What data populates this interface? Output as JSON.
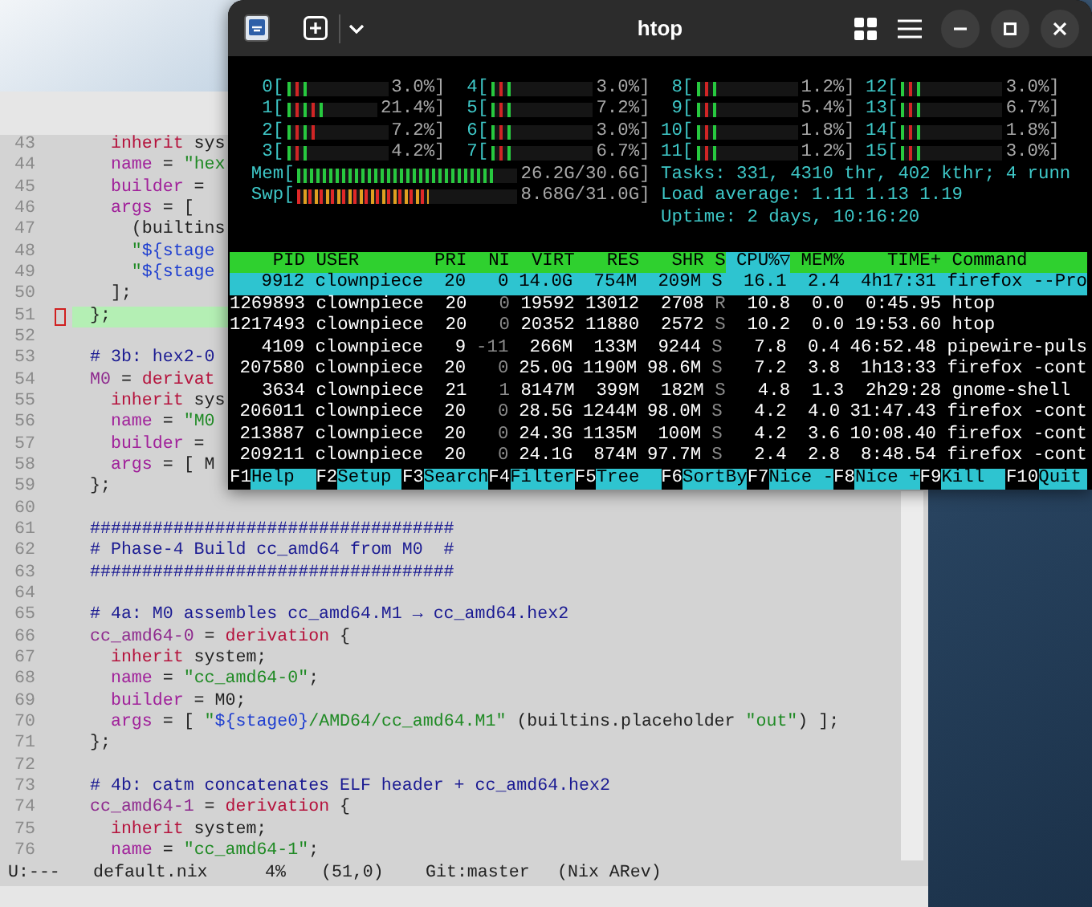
{
  "editor": {
    "lines": [
      {
        "number": "43",
        "current": false,
        "segments": [
          {
            "kind": "keyword",
            "text": "  inherit"
          },
          {
            "kind": "plain",
            "text": " sys"
          }
        ]
      },
      {
        "number": "44",
        "current": false,
        "segments": [
          {
            "kind": "attr",
            "text": "  name"
          },
          {
            "kind": "plain",
            "text": " = "
          },
          {
            "kind": "string",
            "text": "\"hex"
          }
        ]
      },
      {
        "number": "45",
        "current": false,
        "segments": [
          {
            "kind": "attr",
            "text": "  builder"
          },
          {
            "kind": "plain",
            "text": " ="
          }
        ]
      },
      {
        "number": "46",
        "current": false,
        "segments": [
          {
            "kind": "attr",
            "text": "  args"
          },
          {
            "kind": "plain",
            "text": " = ["
          }
        ]
      },
      {
        "number": "47",
        "current": false,
        "segments": [
          {
            "kind": "plain",
            "text": "    (builtins"
          }
        ]
      },
      {
        "number": "48",
        "current": false,
        "segments": [
          {
            "kind": "string",
            "text": "    \""
          },
          {
            "kind": "interp",
            "text": "${stage"
          }
        ]
      },
      {
        "number": "49",
        "current": false,
        "segments": [
          {
            "kind": "string",
            "text": "    \""
          },
          {
            "kind": "interp",
            "text": "${stage"
          }
        ]
      },
      {
        "number": "50",
        "current": false,
        "segments": [
          {
            "kind": "plain",
            "text": "  ];"
          }
        ]
      },
      {
        "number": "51",
        "current": true,
        "segments": [
          {
            "kind": "plain",
            "text": "};"
          }
        ]
      },
      {
        "number": "52",
        "current": false
      },
      {
        "number": "53",
        "current": false,
        "segments": [
          {
            "kind": "comment",
            "text": "# 3b: hex2-0"
          }
        ]
      },
      {
        "number": "54",
        "current": false,
        "segments": [
          {
            "kind": "var",
            "text": "M0"
          },
          {
            "kind": "plain",
            "text": " = "
          },
          {
            "kind": "keyword",
            "text": "derivat"
          }
        ]
      },
      {
        "number": "55",
        "current": false,
        "segments": [
          {
            "kind": "keyword",
            "text": "  inherit"
          },
          {
            "kind": "plain",
            "text": " sys"
          }
        ]
      },
      {
        "number": "56",
        "current": false,
        "segments": [
          {
            "kind": "attr",
            "text": "  name"
          },
          {
            "kind": "plain",
            "text": " = "
          },
          {
            "kind": "string",
            "text": "\"M0"
          }
        ]
      },
      {
        "number": "57",
        "current": false,
        "segments": [
          {
            "kind": "attr",
            "text": "  builder"
          },
          {
            "kind": "plain",
            "text": " ="
          }
        ]
      },
      {
        "number": "58",
        "current": false,
        "segments": [
          {
            "kind": "attr",
            "text": "  args"
          },
          {
            "kind": "plain",
            "text": " = [ M"
          }
        ]
      },
      {
        "number": "59",
        "current": false,
        "segments": [
          {
            "kind": "plain",
            "text": "};"
          }
        ]
      },
      {
        "number": "60",
        "current": false
      },
      {
        "number": "61",
        "current": false,
        "segments": [
          {
            "kind": "comment",
            "text": "###################################"
          }
        ]
      },
      {
        "number": "62",
        "current": false,
        "segments": [
          {
            "kind": "comment",
            "text": "# Phase-4 Build cc_amd64 from M0  #"
          }
        ]
      },
      {
        "number": "63",
        "current": false,
        "segments": [
          {
            "kind": "comment",
            "text": "###################################"
          }
        ]
      },
      {
        "number": "64",
        "current": false
      },
      {
        "number": "65",
        "current": false,
        "segments": [
          {
            "kind": "comment",
            "text": "# 4a: M0 assembles cc_amd64.M1 → cc_amd64.hex2"
          }
        ]
      },
      {
        "number": "66",
        "current": false,
        "segments": [
          {
            "kind": "var",
            "text": "cc_amd64-0"
          },
          {
            "kind": "plain",
            "text": " = "
          },
          {
            "kind": "keyword",
            "text": "derivation"
          },
          {
            "kind": "plain",
            "text": " {"
          }
        ]
      },
      {
        "number": "67",
        "current": false,
        "segments": [
          {
            "kind": "keyword",
            "text": "  inherit"
          },
          {
            "kind": "plain",
            "text": " system;"
          }
        ]
      },
      {
        "number": "68",
        "current": false,
        "segments": [
          {
            "kind": "attr",
            "text": "  name"
          },
          {
            "kind": "plain",
            "text": " = "
          },
          {
            "kind": "string",
            "text": "\"cc_amd64-0\""
          },
          {
            "kind": "plain",
            "text": ";"
          }
        ]
      },
      {
        "number": "69",
        "current": false,
        "segments": [
          {
            "kind": "attr",
            "text": "  builder"
          },
          {
            "kind": "plain",
            "text": " = M0;"
          }
        ]
      },
      {
        "number": "70",
        "current": false,
        "segments": [
          {
            "kind": "attr",
            "text": "  args"
          },
          {
            "kind": "plain",
            "text": " = [ "
          },
          {
            "kind": "string",
            "text": "\""
          },
          {
            "kind": "interp",
            "text": "${stage0}"
          },
          {
            "kind": "string",
            "text": "/AMD64/cc_amd64.M1\""
          },
          {
            "kind": "plain",
            "text": " (builtins.placeholder "
          },
          {
            "kind": "string",
            "text": "\"out\""
          },
          {
            "kind": "plain",
            "text": ") ];"
          }
        ]
      },
      {
        "number": "71",
        "current": false,
        "segments": [
          {
            "kind": "plain",
            "text": "};"
          }
        ]
      },
      {
        "number": "72",
        "current": false
      },
      {
        "number": "73",
        "current": false,
        "segments": [
          {
            "kind": "comment",
            "text": "# 4b: catm concatenates ELF header + cc_amd64.hex2"
          }
        ]
      },
      {
        "number": "74",
        "current": false,
        "segments": [
          {
            "kind": "var",
            "text": "cc_amd64-1"
          },
          {
            "kind": "plain",
            "text": " = "
          },
          {
            "kind": "keyword",
            "text": "derivation"
          },
          {
            "kind": "plain",
            "text": " {"
          }
        ]
      },
      {
        "number": "75",
        "current": false,
        "segments": [
          {
            "kind": "keyword",
            "text": "  inherit"
          },
          {
            "kind": "plain",
            "text": " system;"
          }
        ]
      },
      {
        "number": "76",
        "current": false,
        "segments": [
          {
            "kind": "attr",
            "text": "  name"
          },
          {
            "kind": "plain",
            "text": " = "
          },
          {
            "kind": "string",
            "text": "\"cc_amd64-1\""
          },
          {
            "kind": "plain",
            "text": ";"
          }
        ]
      }
    ],
    "mode_line": [
      "U:---",
      "default.nix",
      "4%",
      "(51,0)",
      "Git:master",
      "(Nix ARev)"
    ]
  },
  "terminal": {
    "title": "htop",
    "cpus": [
      {
        "label": "0[",
        "level": 0.2,
        "reading": "3.0%]"
      },
      {
        "label": "4[",
        "level": 0.2,
        "reading": "3.0%]"
      },
      {
        "label": "8[",
        "level": 0.2,
        "reading": "1.2%]"
      },
      {
        "label": "12[",
        "level": 0.2,
        "reading": "3.0%]"
      },
      {
        "label": "1[",
        "level": 0.45,
        "reading": "21.4%]"
      },
      {
        "label": "5[",
        "level": 0.2,
        "reading": "7.2%]"
      },
      {
        "label": "9[",
        "level": 0.2,
        "reading": "5.4%]"
      },
      {
        "label": "13[",
        "level": 0.2,
        "reading": "6.7%]"
      },
      {
        "label": "2[",
        "level": 0.3,
        "reading": "7.2%]"
      },
      {
        "label": "6[",
        "level": 0.2,
        "reading": "3.0%]"
      },
      {
        "label": "10[",
        "level": 0.2,
        "reading": "1.8%]"
      },
      {
        "label": "14[",
        "level": 0.2,
        "reading": "1.8%]"
      },
      {
        "label": "3[",
        "level": 0.2,
        "reading": "4.2%]"
      },
      {
        "label": "7[",
        "level": 0.2,
        "reading": "6.7%]"
      },
      {
        "label": "11[",
        "level": 0.2,
        "reading": "1.2%]"
      },
      {
        "label": "15[",
        "level": 0.2,
        "reading": "3.0%]"
      }
    ],
    "memory": {
      "label": "Mem[",
      "level": 0.9,
      "reading": "26.2G/30.6G]"
    },
    "swap": {
      "label": "Swp[",
      "level": 0.6,
      "reading": "8.68G/31.0G]"
    },
    "stats": [
      {
        "label": "Tasks:",
        "value": "331, 4310 thr, 402 kthr; 4 runn"
      },
      {
        "label": "Load average:",
        "value": "1.11 1.13 1.19"
      },
      {
        "label": "Uptime:",
        "value": "2 days, 10:16:20"
      }
    ],
    "columns": [
      {
        "label": "PID",
        "sorted": false
      },
      {
        "label": "USER",
        "sorted": false
      },
      {
        "label": "PRI",
        "sorted": false
      },
      {
        "label": "NI",
        "sorted": false
      },
      {
        "label": "VIRT",
        "sorted": false
      },
      {
        "label": "RES",
        "sorted": false
      },
      {
        "label": "SHR",
        "sorted": false
      },
      {
        "label": "S",
        "sorted": false
      },
      {
        "label": "CPU%▽",
        "sorted": true
      },
      {
        "label": "MEM%",
        "sorted": false
      },
      {
        "label": "TIME+",
        "sorted": false
      },
      {
        "label": "Command",
        "sorted": false
      }
    ],
    "processes": [
      {
        "selected": true,
        "cells": [
          "9912",
          "clownpiece",
          "20",
          "0",
          "14.0G",
          "754M",
          "209M",
          "S",
          "16.1",
          "2.4",
          "4h17:31",
          "firefox --Pro"
        ]
      },
      {
        "selected": false,
        "cells": [
          "1269893",
          "clownpiece",
          "20",
          "0",
          "19592",
          "13012",
          "2708",
          "R",
          "10.8",
          "0.0",
          "0:45.95",
          "htop"
        ]
      },
      {
        "selected": false,
        "cells": [
          "1217493",
          "clownpiece",
          "20",
          "0",
          "20352",
          "11880",
          "2572",
          "S",
          "10.2",
          "0.0",
          "19:53.60",
          "htop"
        ]
      },
      {
        "selected": false,
        "cells": [
          "4109",
          "clownpiece",
          "9",
          "-11",
          "266M",
          "133M",
          "9244",
          "S",
          "7.8",
          "0.4",
          "46:52.48",
          "pipewire-puls"
        ]
      },
      {
        "selected": false,
        "cells": [
          "207580",
          "clownpiece",
          "20",
          "0",
          "25.0G",
          "1190M",
          "98.6M",
          "S",
          "7.2",
          "3.8",
          "1h13:33",
          "firefox -cont"
        ]
      },
      {
        "selected": false,
        "cells": [
          "3634",
          "clownpiece",
          "21",
          "1",
          "8147M",
          "399M",
          "182M",
          "S",
          "4.8",
          "1.3",
          "2h29:28",
          "gnome-shell"
        ]
      },
      {
        "selected": false,
        "cells": [
          "206011",
          "clownpiece",
          "20",
          "0",
          "28.5G",
          "1244M",
          "98.0M",
          "S",
          "4.2",
          "4.0",
          "31:47.43",
          "firefox -cont"
        ]
      },
      {
        "selected": false,
        "cells": [
          "213887",
          "clownpiece",
          "20",
          "0",
          "24.3G",
          "1135M",
          "100M",
          "S",
          "4.2",
          "3.6",
          "10:08.40",
          "firefox -cont"
        ]
      },
      {
        "selected": false,
        "cells": [
          "209211",
          "clownpiece",
          "20",
          "0",
          "24.1G",
          "874M",
          "97.7M",
          "S",
          "2.4",
          "2.8",
          "8:48.54",
          "firefox -cont"
        ]
      }
    ],
    "function_keys": [
      {
        "key": "F1",
        "label": "Help"
      },
      {
        "key": "F2",
        "label": "Setup"
      },
      {
        "key": "F3",
        "label": "Search"
      },
      {
        "key": "F4",
        "label": "Filter"
      },
      {
        "key": "F5",
        "label": "Tree"
      },
      {
        "key": "F6",
        "label": "SortBy"
      },
      {
        "key": "F7",
        "label": "Nice -"
      },
      {
        "key": "F8",
        "label": "Nice +"
      },
      {
        "key": "F9",
        "label": "Kill"
      },
      {
        "key": "F10",
        "label": "Quit"
      }
    ]
  }
}
